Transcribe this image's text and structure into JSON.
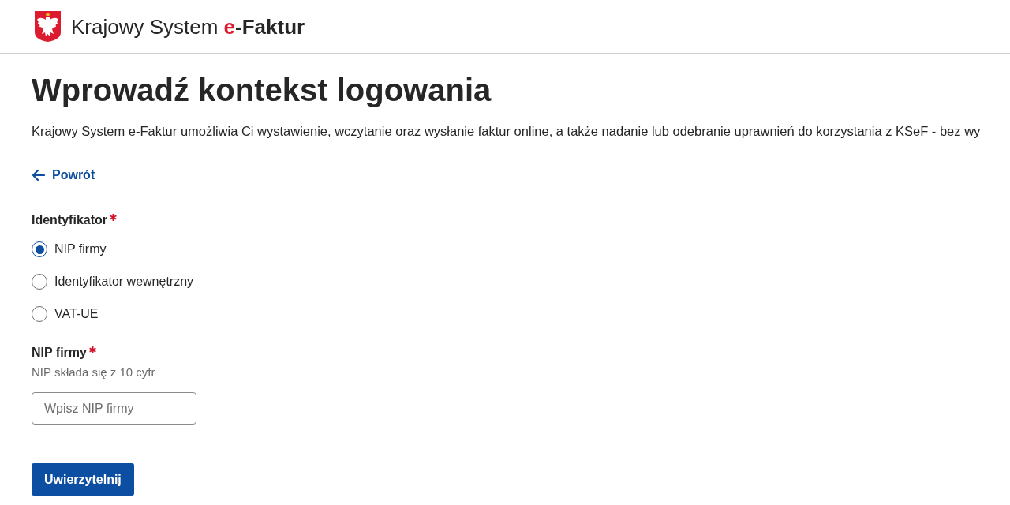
{
  "header": {
    "site_title": {
      "parts": [
        {
          "text": "Krajowy System ",
          "kind": "plain"
        },
        {
          "text": "e",
          "kind": "accent"
        },
        {
          "text": "-Faktur",
          "kind": "strong"
        }
      ]
    }
  },
  "page": {
    "heading": "Wprowadź kontekst logowania",
    "description": "Krajowy System e-Faktur umożliwia Ci wystawienie, wczytanie oraz wysłanie faktur online, a także nadanie lub odebranie uprawnień do korzystania z KSeF - bez wy",
    "back_link": "Powrót"
  },
  "identifier_group": {
    "label": "Identyfikator",
    "required": true,
    "options": [
      {
        "label": "NIP firmy",
        "selected": true
      },
      {
        "label": "Identyfikator wewnętrzny",
        "selected": false
      },
      {
        "label": "VAT-UE",
        "selected": false
      }
    ]
  },
  "nip_field": {
    "label": "NIP firmy",
    "required": true,
    "hint": "NIP składa się z 10 cyfr",
    "placeholder": "Wpisz NIP firmy"
  },
  "submit_button": "Uwierzytelnij"
}
